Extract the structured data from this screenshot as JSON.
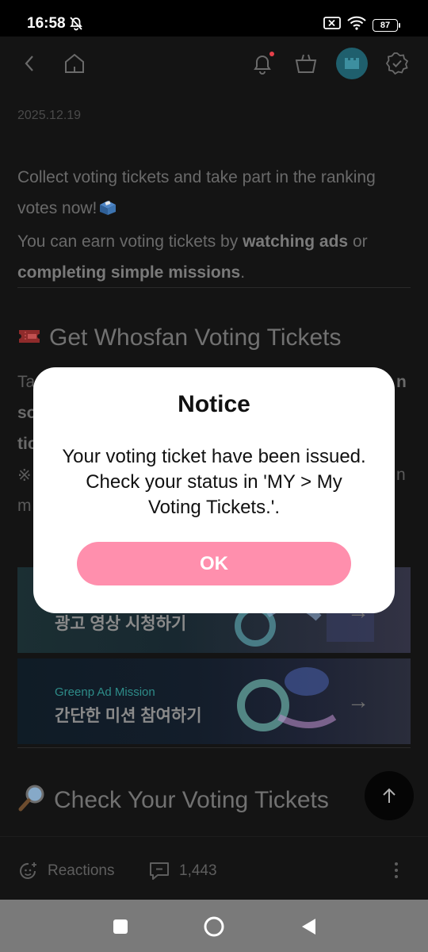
{
  "status_bar": {
    "time": "16:58",
    "battery": "87"
  },
  "post": {
    "date": "2025.12.19",
    "intro_line1": "Collect voting tickets and take part in the ranking votes now!",
    "intro_line2_a": "You can earn voting tickets by ",
    "intro_line2_bold1": "watching ads",
    "intro_line2_b": " or ",
    "intro_line2_bold2": "completing simple missions",
    "intro_line2_c": ".",
    "section1_title": "Get Whosfan Voting Tickets",
    "partial_ta": "Ta",
    "partial_so": "so",
    "partial_tic": "tic",
    "partial_note": "※",
    "partial_m": "m",
    "partial_n_right": "n",
    "partial_n_right2": "n",
    "banners": [
      {
        "sub": "",
        "title": "광고 영상 시청하기"
      },
      {
        "sub": "Greenp Ad Mission",
        "title": "간단한 미션 참여하기"
      }
    ],
    "section2_title": "Check Your Voting Tickets"
  },
  "footer": {
    "reactions_label": "Reactions",
    "comments_count": "1,443"
  },
  "dialog": {
    "title": "Notice",
    "message": "Your voting ticket have been issued. Check your status in 'MY > My Voting Tickets.'.",
    "ok_label": "OK"
  },
  "colors": {
    "accent_pink": "#ff8fad",
    "background": "#141414",
    "dialog_bg": "#ffffff"
  }
}
